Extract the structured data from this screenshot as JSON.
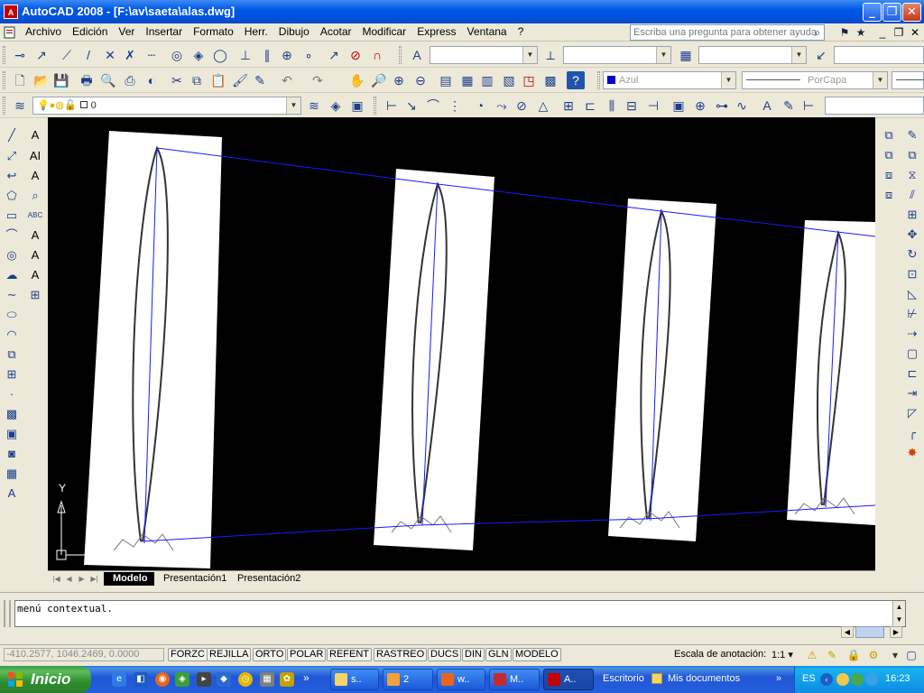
{
  "window": {
    "app_icon": "A",
    "title": "AutoCAD 2008 - [F:\\av\\saeta\\alas.dwg]",
    "controls": {
      "minimize": "_",
      "maximize": "❐",
      "close": "✕"
    }
  },
  "menubar": {
    "items": [
      "Archivo",
      "Edición",
      "Ver",
      "Insertar",
      "Formato",
      "Herr.",
      "Dibujo",
      "Acotar",
      "Modificar",
      "Express",
      "Ventana",
      "?"
    ],
    "help_placeholder": "Escriba una pregunta para obtener ayuda"
  },
  "toolbars": {
    "color_combo": "Azul",
    "linetype_combo": "PorCapa",
    "layer_combo": "0",
    "color_accent": "#0000cc"
  },
  "drawing": {
    "background": "#000000",
    "outline_color": "#1a1aff",
    "ucs_y_label": "Y"
  },
  "tabs": [
    "Modelo",
    "Presentación1",
    "Presentación2"
  ],
  "command_line": {
    "text": "menú contextual."
  },
  "statusbar": {
    "coordinates": "-410.2577, 1046.2469, 0.0000",
    "toggles": [
      "FORZC",
      "REJILLA",
      "ORTO",
      "POLAR",
      "REFENT",
      "RASTREO",
      "DUCS",
      "DIN",
      "GLN",
      "MODELO"
    ],
    "annotation_label": "Escala de anotación:",
    "annotation_scale": "1:1 ▾"
  },
  "taskbar": {
    "start_label": "Inicio",
    "more_label": "»",
    "tasks": [
      {
        "label": "s..",
        "icon_color": "#f6d46a",
        "active": false
      },
      {
        "label": "2",
        "icon_color": "#f2a23a",
        "active": false
      },
      {
        "label": "w..",
        "icon_color": "#e9651d",
        "active": false
      },
      {
        "label": "M..",
        "icon_color": "#c62a2a",
        "active": false
      },
      {
        "label": "A..",
        "icon_color": "#c40000",
        "active": true
      }
    ],
    "desk_items": [
      "Escritorio",
      "Mis documentos"
    ],
    "language": "ES",
    "clock": "16:23"
  }
}
